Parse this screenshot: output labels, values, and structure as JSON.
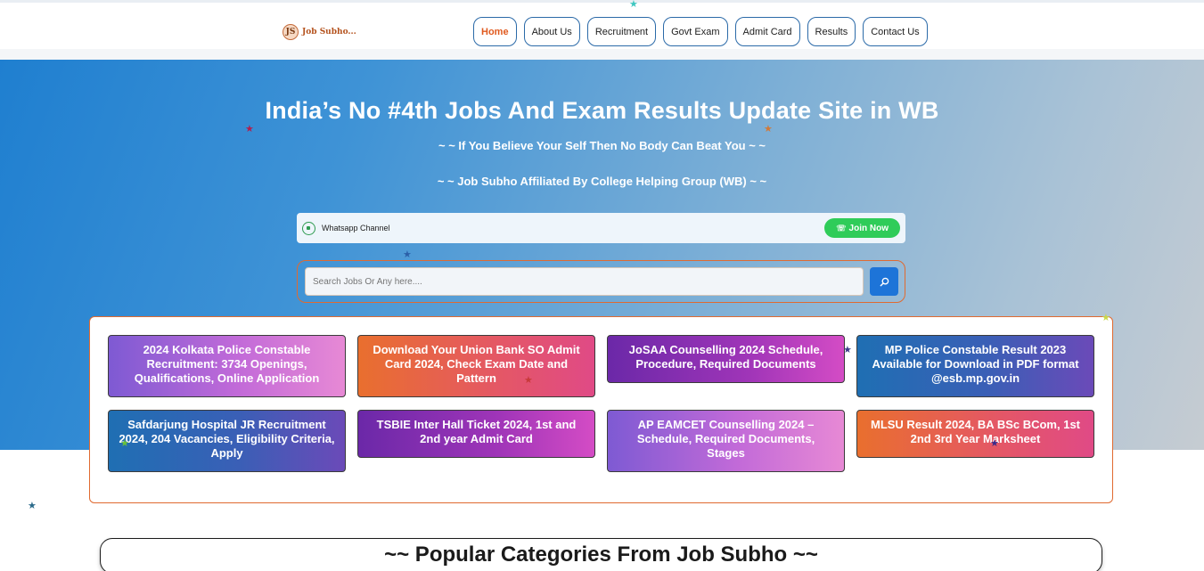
{
  "header": {
    "logo_glyph": "JS",
    "logo_text": "Job Subho...",
    "nav": [
      {
        "label": "Home",
        "active": true
      },
      {
        "label": "About Us",
        "active": false
      },
      {
        "label": "Recruitment",
        "active": false
      },
      {
        "label": "Govt Exam",
        "active": false
      },
      {
        "label": "Admit Card",
        "active": false
      },
      {
        "label": "Results",
        "active": false
      },
      {
        "label": "Contact Us",
        "active": false
      }
    ]
  },
  "hero": {
    "title": "India’s No #4th Jobs And Exam Results Update Site in WB",
    "subtitle1": "~ ~ If You Believe Your Self Then No Body Can Beat You ~ ~",
    "subtitle2": "~ ~ Job Subho Affiliated By College Helping Group (WB) ~ ~"
  },
  "whatsapp": {
    "label": "Whatsapp Channel",
    "join_label": "Join Now",
    "icon": "whatsapp-icon"
  },
  "search": {
    "placeholder": "Search Jobs Or Any here....",
    "icon": "search-icon"
  },
  "cards": [
    "2024 Kolkata Police Constable Recruitment: 3734 Openings, Qualifications, Online Application",
    "Download Your Union Bank SO Admit Card 2024, Check Exam Date and Pattern",
    "JoSAA Counselling 2024 Schedule, Procedure, Required Documents",
    "MP Police Constable Result 2023 Available for Download in PDF format @esb.mp.gov.in",
    "Safdarjung Hospital JR Recruitment 2024, 204 Vacancies, Eligibility Criteria, Apply",
    "TSBIE Inter Hall Ticket 2024, 1st and 2nd year Admit Card",
    "AP EAMCET Counselling 2024 – Schedule, Required Documents, Stages",
    "MLSU Result 2024, BA BSc BCom, 1st 2nd 3rd Year Marksheet"
  ],
  "popular": {
    "title": "~~ Popular Categories From Job Subho ~~"
  },
  "colors": {
    "accent_orange": "#e06a30",
    "nav_border": "#2b6aa8",
    "whatsapp_green": "#2fcc59",
    "search_blue": "#1d74d8"
  }
}
